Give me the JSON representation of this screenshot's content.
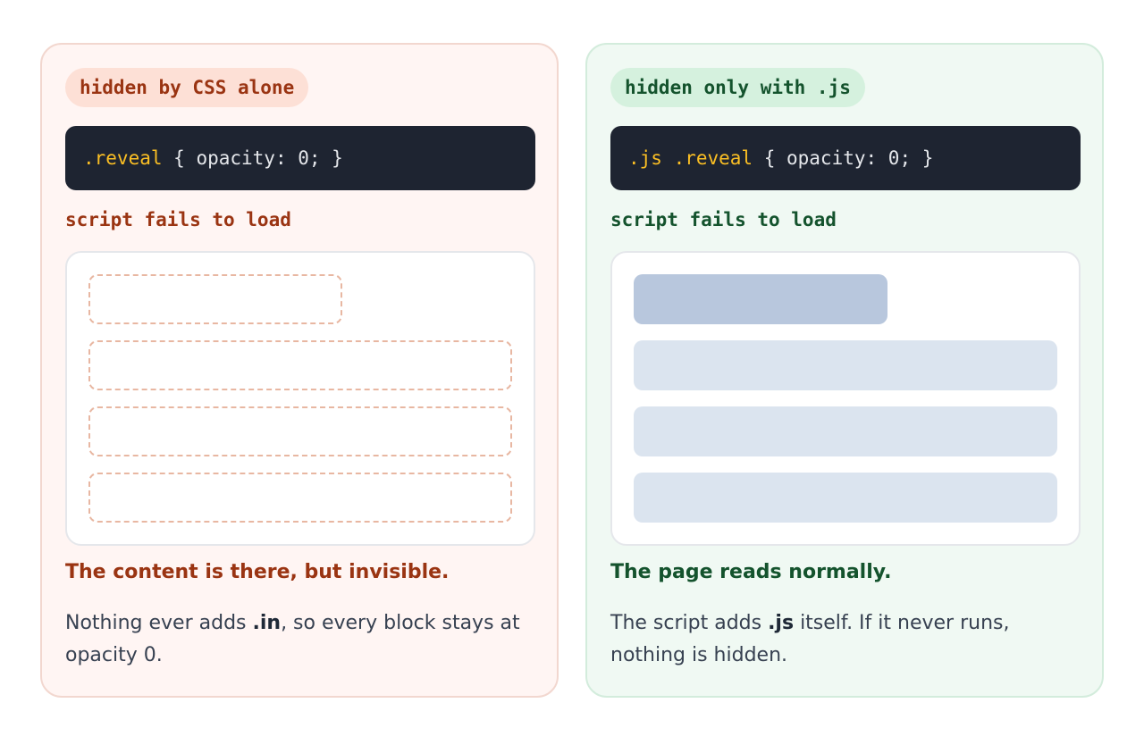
{
  "left_panel": {
    "badge": "hidden by CSS alone",
    "code": {
      "selector": ".reveal",
      "rule": " { opacity: 0; }"
    },
    "label": "script fails to load",
    "heading": "The content is there, but invisible.",
    "desc": {
      "before": "Nothing ever adds ",
      "strong": ".in",
      "after": ", so every block stays at opacity 0."
    },
    "accent_color": "#9a3412"
  },
  "right_panel": {
    "badge": "hidden only with .js",
    "code": {
      "selector": ".js .reveal",
      "rule": " { opacity: 0; }"
    },
    "label": "script fails to load",
    "heading": "The page reads normally.",
    "desc": {
      "before": "The script adds ",
      "strong": ".js",
      "after": " itself. If it never runs, nothing is hidden."
    },
    "accent_color": "#14532d"
  }
}
